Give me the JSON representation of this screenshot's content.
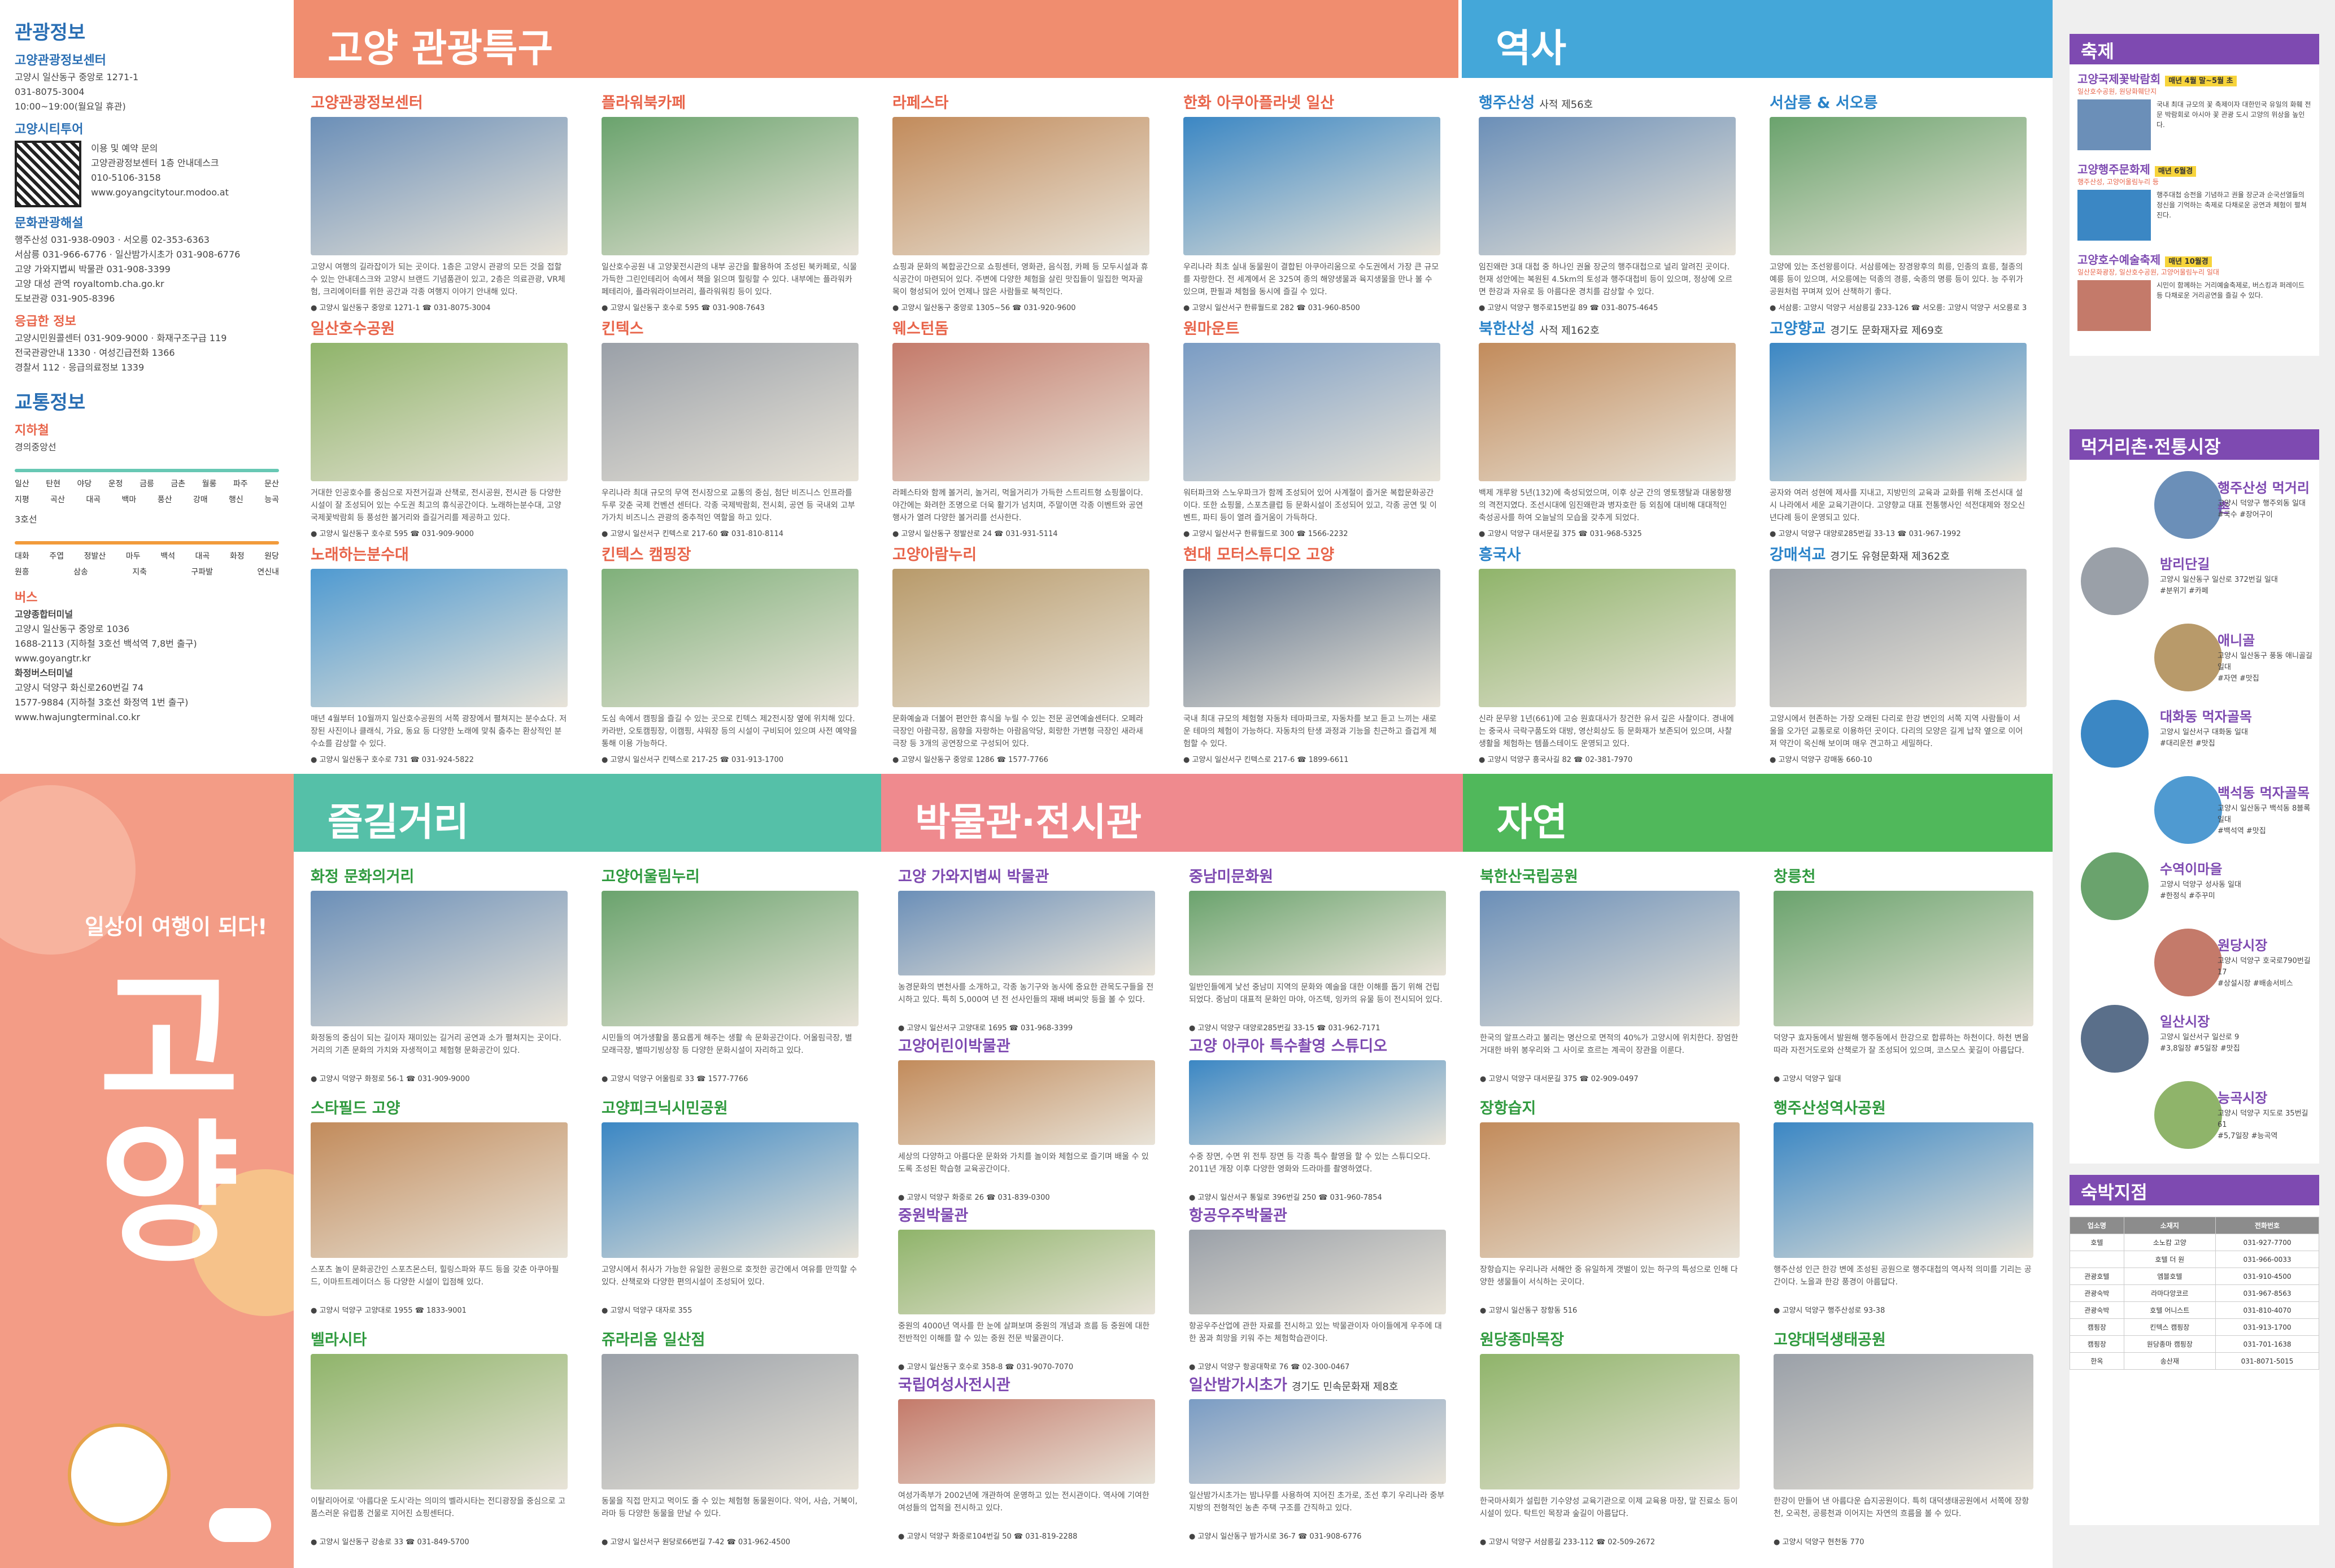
{
  "left": {
    "info_title": "관광정보",
    "center_name": "고양관광정보센터",
    "center_addr": "고양시 일산동구 중앙로 1271-1",
    "center_tel": "031-8075-3004",
    "center_hours": "10:00~19:00(월요일 휴관)",
    "citytour_title": "고양시티투어",
    "citytour_inquiry": "이용 및 예약 문의",
    "citytour_place": "고양관광정보센터 1층 안내데스크",
    "citytour_tel": "010-5106-3158",
    "citytour_web": "www.goyangcitytour.modoo.at",
    "culture_title": "문화관광해설",
    "culture_lines": [
      "행주산성 031-938-0903 · 서오릉 02-353-6363",
      "서삼릉 031-966-6776 · 일산밤가시초가 031-908-6776",
      "고양 가와지볍씨 박물관 031-908-3399",
      "고양 대성 관역 royaltomb.cha.go.kr",
      "도보관광 031-905-8396"
    ],
    "emergency_title": "응급한 정보",
    "emergency_lines": [
      "고양시민원콜센터 031-909-9000 · 화재구조구급 119",
      "전국관광안내 1330 · 여성긴급전화 1366",
      "경찰서 112 · 응급의료정보 1339"
    ],
    "transport_title": "교통정보",
    "subway_title": "지하철",
    "line_gyeongui": "경의중앙선",
    "stations_gyeongui": [
      "일산",
      "탄현",
      "야당",
      "운정",
      "금릉",
      "금촌",
      "월롱",
      "파주",
      "문산"
    ],
    "stations_gyeongui2": [
      "지평",
      "곡산",
      "대곡",
      "백마",
      "풍산",
      "강매",
      "행신",
      "능곡"
    ],
    "line_3": "3호선",
    "stations_3": [
      "대화",
      "주엽",
      "정발산",
      "마두",
      "백석",
      "대곡",
      "화정",
      "원당"
    ],
    "stations_3b": [
      "원흥",
      "삼송",
      "지축",
      "구파발",
      "연신내"
    ],
    "bus_title": "버스",
    "bus_terminal": "고양종합터미널",
    "bus_terminal_addr": "고양시 일산동구 중앙로 1036",
    "bus_terminal_tel": "1688-2113 (지하철 3호선 백석역 7,8번 출구)",
    "bus_terminal_web": "www.goyangtr.kr",
    "bus_hwajeong": "화정버스터미널",
    "bus_hwajeong_addr": "고양시 덕양구 화신로260번길 74",
    "bus_hwajeong_tel": "1577-9884 (지하철 3호선 화정역 1번 출구)",
    "bus_hwajeong_web": "www.hwajungterminal.co.kr",
    "cover_slogan": "일상이 여행이 되다!",
    "cover_big": "고양"
  },
  "sections": {
    "tour": "고양 관광특구",
    "history": "역사",
    "street": "즐길거리",
    "museum": "박물관·전시관",
    "nature": "자연"
  },
  "tour_cards": [
    {
      "title": "고양관광정보센터",
      "sub": "",
      "desc": "고양시 여행의 길라잡이가 되는 곳이다. 1층은 고양시 관광의 모든 것을 접할 수 있는 안내데스크와 고양시 브랜드 기념품관이 있고, 2층은 의료관광, VR체험, 크리에이터를 위한 공간과 각종 여행지 이야기 안내해 있다.",
      "addr": "고양시 일산동구 중앙로 1271-1",
      "tel": "031-8075-3004"
    },
    {
      "title": "플라워북카페",
      "sub": "",
      "desc": "일산호수공원 내 고양꽃전시관의 내부 공간을 활용하여 조성된 북카페로, 식물 가득한 그린인테리어 속에서 책을 읽으며 힐링할 수 있다. 내부에는 플라워카페테리아, 플라워라이브러리, 플라워워킹 등이 있다.",
      "addr": "고양시 일산동구 호수로 595",
      "tel": "031-908-7643"
    },
    {
      "title": "라페스타",
      "sub": "",
      "desc": "쇼핑과 문화의 복합공간으로 쇼핑센터, 영화관, 음식점, 카페 등 모두시설과 휴식공간이 마련되어 있다. 주변에 다양한 체험을 살린 맛집들이 밀집한 먹자골목이 형성되어 있어 언제나 많은 사람들로 북적인다.",
      "addr": "고양시 일산동구 중앙로 1305~56",
      "tel": "031-920-9600"
    },
    {
      "title": "한화 아쿠아플라넷 일산",
      "sub": "",
      "desc": "우리나라 최초 실내 동물원이 결합된 아쿠아리움으로 수도권에서 가장 큰 규모를 자랑한다. 전 세계에서 온 325여 종의 해양생물과 육지생물을 만나 볼 수 있으며, 판필과 체험을 동시에 즐길 수 있다.",
      "addr": "고양시 일산서구 한류월드로 282",
      "tel": "031-960-8500"
    },
    {
      "title": "일산호수공원",
      "sub": "",
      "desc": "거대한 인공호수를 중심으로 자전거길과 산책로, 전시공원, 전시관 등 다양한 시설이 잘 조성되어 있는 수도권 최고의 휴식공간이다. 노래하는분수대, 고양국제꽃박람회 등 풍성한 볼거리와 즐길거리를 제공하고 있다.",
      "addr": "고양시 일산동구 호수로 595",
      "tel": "031-909-9000"
    },
    {
      "title": "킨텍스",
      "sub": "",
      "desc": "우리나라 최대 규모의 무역 전시장으로 교통의 중심, 첨단 비즈니스 인프라를 두루 갖춘 국제 컨벤션 센터다. 각종 국제박람회, 전시회, 공연 등 국내외 고부가가치 비즈니스 관광의 중추적인 역할을 하고 있다.",
      "addr": "고양시 일산서구 킨텍스로 217-60",
      "tel": "031-810-8114"
    },
    {
      "title": "웨스턴돔",
      "sub": "",
      "desc": "라페스타와 함께 볼거리, 놀거리, 먹을거리가 가득한 스트리트형 쇼핑몰이다. 야간에는 화려한 조명으로 더욱 활기가 넘치며, 주말이면 각종 이벤트와 공연 행사가 열려 다양한 볼거리를 선사한다.",
      "addr": "고양시 일산동구 정발산로 24",
      "tel": "031-931-5114"
    },
    {
      "title": "원마운트",
      "sub": "",
      "desc": "워터파크와 스노우파크가 함께 조성되어 있어 사계절이 즐거운 복합문화공간이다. 또한 쇼핑몰, 스포츠클럽 등 문화시설이 조성되어 있고, 각종 공연 및 이벤트, 파티 등이 열려 즐거움이 가득하다.",
      "addr": "고양시 일산서구 한류월드로 300",
      "tel": "1566-2232"
    },
    {
      "title": "노래하는분수대",
      "sub": "",
      "desc": "매년 4월부터 10월까지 일산호수공원의 서쪽 광장에서 펼쳐지는 분수쇼다. 저장된 사진이나 클래식, 가요, 동요 등 다양한 노래에 맞춰 춤추는 환상적인 분수쇼를 감상할 수 있다.",
      "addr": "고양시 일산동구 호수로 731",
      "tel": "031-924-5822"
    },
    {
      "title": "킨텍스 캠핑장",
      "sub": "",
      "desc": "도심 속에서 캠핑을 즐길 수 있는 곳으로 킨텍스 제2전시장 옆에 위치해 있다. 카라반, 오토캠핑장, 이캠핑, 샤워장 등의 시설이 구비되어 있으며 사전 예약을 통해 이용 가능하다.",
      "addr": "고양시 일산서구 킨텍스로 217-25",
      "tel": "031-913-1700"
    },
    {
      "title": "고양아람누리",
      "sub": "",
      "desc": "문화예술과 더불어 편안한 휴식을 누릴 수 있는 전문 공연예술센터다. 오페라극장인 아람극장, 음향을 자랑하는 아람음악당, 회랑한 가변형 극장인 새라새극장 등 3개의 공연장으로 구성되어 있다.",
      "addr": "고양시 일산동구 중앙로 1286",
      "tel": "1577-7766"
    },
    {
      "title": "현대 모터스튜디오 고양",
      "sub": "",
      "desc": "국내 최대 규모의 체험형 자동차 테마파크로, 자동차를 보고 듣고 느끼는 새로운 테마의 체험이 가능하다. 자동차의 탄생 과정과 기능을 친근하고 즐겁게 체험할 수 있다.",
      "addr": "고양시 일산서구 킨텍스로 217-6",
      "tel": "1899-6611"
    }
  ],
  "history_cards": [
    {
      "title": "행주산성",
      "sub": "사적 제56호",
      "desc": "임진왜란 3대 대첩 중 하나인 권율 장군의 행주대첩으로 널리 알려진 곳이다. 현재 성안에는 복원된 4.5km의 토성과 행주대첩비 등이 있으며, 정상에 오르면 한강과 자유로 등 아름다운 경치를 감상할 수 있다.",
      "addr": "고양시 덕양구 행주로15번길 89",
      "tel": "031-8075-4645"
    },
    {
      "title": "서삼릉 & 서오릉",
      "sub": "",
      "desc": "고양에 있는 조선왕릉이다. 서삼릉에는 장경왕후의 희릉, 인종의 효릉, 철종의 예릉 등이 있으며, 서오릉에는 덕종의 경릉, 숙종의 명릉 등이 있다. 능 주위가 공원처럼 꾸며져 있어 산책하기 좋다.",
      "addr": "서삼릉: 고양시 덕양구 서삼릉길 233-126",
      "tel": "서오릉: 고양시 덕양구 서오릉로 334-32"
    },
    {
      "title": "북한산성",
      "sub": "사적 제162호",
      "desc": "백제 개루왕 5년(132)에 축성되었으며, 이후 상군 간의 영토쟁탈과 대몽항쟁의 격전지였다. 조선시대에 임진왜란과 병자호란 등 외침에 대비해 대대적인 축성공사를 하여 오늘날의 모습을 갖추게 되었다.",
      "addr": "고양시 덕양구 대서문길 375",
      "tel": "031-968-5325"
    },
    {
      "title": "고양향교",
      "sub": "경기도 문화재자료 제69호",
      "desc": "공자와 여러 성현에 제사를 지내고, 지방민의 교육과 교화를 위해 조선시대 설시 나라에서 세운 교육기관이다. 고양향교 대표 전통행사인 석전대제와 정오신년다례 등이 운영되고 있다.",
      "addr": "고양시 덕양구 대양로285번길 33-13",
      "tel": "031-967-1992"
    },
    {
      "title": "흥국사",
      "sub": "",
      "desc": "신라 문무왕 1년(661)에 고승 원효대사가 창건한 유서 깊은 사찰이다. 경내에는 중국사 극락구품도와 대방, 영산회상도 등 문화재가 보존되어 있으며, 사찰 생활을 체험하는 템플스테이도 운영되고 있다.",
      "addr": "고양시 덕양구 흥국사길 82",
      "tel": "02-381-7970"
    },
    {
      "title": "강매석교",
      "sub": "경기도 유형문화재 제362호",
      "desc": "고양시에서 현존하는 가장 오래된 다리로 한강 변인의 서쪽 지역 사람들이 서울을 오가던 교통로로 이용하던 곳이다. 다리의 모양은 길게 납작 옆으로 이어져 약간이 옥신해 보이며 매우 견고하고 세밀하다.",
      "addr": "고양시 덕양구 강매동 660-10",
      "tel": ""
    }
  ],
  "street_cards": [
    {
      "title": "화정 문화의거리",
      "desc": "화정동의 중심이 되는 길이자 재미있는 길거리 공연과 소가 펼쳐지는 곳이다. 거리의 기존 문화의 가치와 자생적이고 체험형 문화공간이 있다.",
      "addr": "고양시 덕양구 화정로 56-1",
      "tel": "031-909-9000"
    },
    {
      "title": "고양어울림누리",
      "desc": "시민들의 여가생활을 풍요롭게 해주는 생활 속 문화공간이다. 어울림극장, 별모래극장, 별따기빙상장 등 다양한 문화시설이 자리하고 있다.",
      "addr": "고양시 덕양구 어울림로 33",
      "tel": "1577-7766"
    },
    {
      "title": "스타필드 고양",
      "desc": "스포츠 놀이 문화공간인 스포츠몬스터, 힐링스파와 푸드 등을 갖춘 아쿠아필드, 이마트트레이더스 등 다양한 시설이 입점해 있다.",
      "addr": "고양시 덕양구 고양대로 1955",
      "tel": "1833-9001"
    },
    {
      "title": "고양피크닉시민공원",
      "desc": "고양시에서 취사가 가능한 유일한 공원으로 호젓한 공간에서 여유를 만끽할 수 있다. 산책로와 다양한 편의시설이 조성되어 있다.",
      "addr": "고양시 덕양구 대자로 355",
      "tel": ""
    },
    {
      "title": "벨라시타",
      "desc": "이탈리아어로 '아름다운 도시'라는 의미의 벨라시타는 전디광장을 중심으로 고품스러운 유럽풍 건물로 지어진 쇼핑센터다.",
      "addr": "고양시 일산동구 강송로 33",
      "tel": "031-849-5700"
    },
    {
      "title": "쥬라리움 일산점",
      "desc": "동물을 직접 만지고 먹이도 줄 수 있는 체험형 동물원이다. 악어, 사슴, 거북이, 라마 등 다양한 동물을 만날 수 있다.",
      "addr": "고양시 일산서구 원당로66번길 7-42",
      "tel": "031-962-4500"
    }
  ],
  "museum_cards": [
    {
      "title": "고양 가와지볍씨 박물관",
      "desc": "농경문화의 변천사를 소개하고, 각종 농기구와 농사에 중요한 관목도구들을 전시하고 있다. 특히 5,000여 년 전 선사인들의 재배 벼씨앗 등을 볼 수 있다.",
      "addr": "고양시 일산서구 고양대로 1695",
      "tel": "031-968-3399"
    },
    {
      "title": "중남미문화원",
      "desc": "일반인들에게 낯선 중남미 지역의 문화와 예술을 대한 이해를 돕기 위해 건립되었다. 중남미 대표적 문화인 마야, 아즈텍, 잉카의 유물 등이 전시되어 있다.",
      "addr": "고양시 덕양구 대양로285번길 33-15",
      "tel": "031-962-7171"
    },
    {
      "title": "고양어린이박물관",
      "desc": "세상의 다양하고 아름다운 문화와 가치를 놀이와 체험으로 즐기며 배울 수 있도록 조성된 학습형 교육공간이다.",
      "addr": "고양시 덕양구 화중로 26",
      "tel": "031-839-0300"
    },
    {
      "title": "고양 아쿠아 특수촬영 스튜디오",
      "desc": "수중 장면, 수면 위 전투 장면 등 각종 특수 촬영을 할 수 있는 스튜디오다. 2011년 개장 이후 다양한 영화와 드라마를 촬영하였다.",
      "addr": "고양시 일산서구 통일로 396번길 250",
      "tel": "031-960-7854"
    },
    {
      "title": "중원박물관",
      "desc": "중원의 4000년 역사를 한 눈에 살펴보며 중원의 개념과 흐름 등 중원에 대한 전반적인 이해를 할 수 있는 중원 전문 박물관이다.",
      "addr": "고양시 일산동구 호수로 358-8",
      "tel": "031-9070-7070"
    },
    {
      "title": "항공우주박물관",
      "desc": "항공우주산업에 관한 자료를 전시하고 있는 박물관이자 아이들에게 우주에 대한 꿈과 희망을 키워 주는 체험학습관이다.",
      "addr": "고양시 덕양구 항공대학로 76",
      "tel": "02-300-0467"
    },
    {
      "title": "국립여성사전시관",
      "desc": "여성가족부가 2002년에 개관하여 운영하고 있는 전시관이다. 역사에 기여한 여성들의 업적을 전시하고 있다.",
      "addr": "고양시 덕양구 화중로104번길 50",
      "tel": "031-819-2288"
    },
    {
      "title": "일산밤가시초가",
      "sub": "경기도 민속문화재 제8호",
      "desc": "일산밤가시초가는 밤나무를 사용하여 지어진 초가로, 조선 후기 우리나라 중부지방의 전형적인 농촌 주택 구조를 간직하고 있다.",
      "addr": "고양시 일산동구 밤가시로 36-7",
      "tel": "031-908-6776"
    }
  ],
  "nature_cards": [
    {
      "title": "북한산국립공원",
      "desc": "한국의 알프스라고 불리는 명산으로 면적의 40%가 고양시에 위치한다. 장엄한 거대한 바위 봉우리와 그 사이로 흐르는 계곡이 장관을 이룬다.",
      "addr": "고양시 덕양구 대서문길 375",
      "tel": "02-909-0497"
    },
    {
      "title": "창릉천",
      "desc": "덕양구 효자동에서 발원해 행주동에서 한강으로 합류하는 하천이다. 하천 변을 따라 자전거도로와 산책로가 잘 조성되어 있으며, 코스모스 꽃길이 아름답다.",
      "addr": "고양시 덕양구 일대",
      "tel": ""
    },
    {
      "title": "장항습지",
      "desc": "장항습지는 우리나라 서해안 중 유일하게 갯벌이 있는 하구의 특성으로 인해 다양한 생물들이 서식하는 곳이다.",
      "addr": "고양시 일산동구 장항동 516",
      "tel": ""
    },
    {
      "title": "행주산성역사공원",
      "desc": "행주산성 인근 한강 변에 조성된 공원으로 행주대첩의 역사적 의미를 기리는 공간이다. 노을과 한강 풍경이 아름답다.",
      "addr": "고양시 덕양구 행주산성로 93-38",
      "tel": ""
    },
    {
      "title": "원당종마목장",
      "desc": "한국마사회가 설립한 기수양성 교육기관으로 이제 교육용 마장, 말 진료소 등이 시설이 있다. 탁트인 목장과 숲길이 아름답다.",
      "addr": "고양시 덕양구 서삼릉길 233-112",
      "tel": "02-509-2672"
    },
    {
      "title": "고양대덕생태공원",
      "desc": "한강이 만들어 낸 아름다운 습지공원이다. 특히 대덕생태공원에서 서쪽에 장항천, 오곡천, 공릉천과 이어지는 자연의 흐름을 볼 수 있다.",
      "addr": "고양시 덕양구 현천동 770",
      "tel": ""
    }
  ],
  "right": {
    "festival_title": "축제",
    "festivals": [
      {
        "name": "고양국제꽃박람회",
        "badge": "매년 4월 말~5월 초",
        "place": "일산호수공원, 원당화훼단지",
        "desc": "국내 최대 규모의 꽃 축제이자 대한민국 유일의 화훼 전문 박람회로 아시아 꽃 관광 도시 고양의 위상을 높인다."
      },
      {
        "name": "고양행주문화제",
        "badge": "매년 6월경",
        "place": "행주산성, 고양어울림누리 등",
        "desc": "행주대첩 승전을 기념하고 권율 장군과 순국선열들의 정신을 기억하는 축제로 다채로운 공연과 체험이 펼쳐진다."
      },
      {
        "name": "고양호수예술축제",
        "badge": "매년 10월경",
        "place": "일산문화광장, 일산호수공원, 고양어울림누리 일대",
        "desc": "시민이 함께하는 거리예술축제로, 버스킹과 퍼레이드 등 다채로운 거리공연을 즐길 수 있다."
      }
    ],
    "food_title": "먹거리촌·전통시장",
    "foods": [
      {
        "name": "행주산성 먹거리촌",
        "addr": "고양시 덕양구 행주외동 일대",
        "tag": "#국수 #장어구이"
      },
      {
        "name": "밤리단길",
        "addr": "고양시 일산동구 일산로 372번길 일대",
        "tag": "#분위기 #카페"
      },
      {
        "name": "애니골",
        "addr": "고양시 일산동구 풍동 애니골길 일대",
        "tag": "#자연 #맛집"
      },
      {
        "name": "대화동 먹자골목",
        "addr": "고양시 일산서구 대화동 일대",
        "tag": "#대리운전 #맛집"
      },
      {
        "name": "백석동 먹자골목",
        "addr": "고양시 일산동구 백석동 8블록 일대",
        "tag": "#백석역 #맛집"
      },
      {
        "name": "수역이마을",
        "addr": "고양시 덕양구 성사동 일대",
        "tag": "#한정식 #주꾸미"
      },
      {
        "name": "원당시장",
        "addr": "고양시 덕양구 호국로790번길 17",
        "tag": "#상설시장 #배송서비스"
      },
      {
        "name": "일산시장",
        "addr": "고양시 일산서구 일산로 9",
        "tag": "#3,8일장 #5일장 #맛집"
      },
      {
        "name": "능곡시장",
        "addr": "고양시 덕양구 지도로 35번길 61",
        "tag": "#5,7일장 #능곡역"
      }
    ],
    "lodging_title": "숙박지점",
    "lodging_headers": [
      "업소명",
      "소재지",
      "전화번호"
    ],
    "lodging_rows": [
      [
        "호텔",
        "소노캄 고양",
        "031-927-7700"
      ],
      [
        "",
        "호텔 더 원",
        "031-966-0033"
      ],
      [
        "관광호텔",
        "엠블호텔",
        "031-910-4500"
      ],
      [
        "관광숙박",
        "라마다앙코르",
        "031-967-8563"
      ],
      [
        "관광숙박",
        "호텔 어니스트",
        "031-810-4070"
      ],
      [
        "캠핑장",
        "킨텍스 캠핑장",
        "031-913-1700"
      ],
      [
        "캠핑장",
        "원당종마 캠핑장",
        "031-701-1638"
      ],
      [
        "한옥",
        "송산재",
        "031-8071-5015"
      ]
    ]
  },
  "colors": {
    "tour": "#f08d6f",
    "history": "#44a7d9",
    "street": "#55c0a8",
    "museum": "#ef8a8e",
    "nature": "#50b85b",
    "accent": "#7e4ab1"
  }
}
